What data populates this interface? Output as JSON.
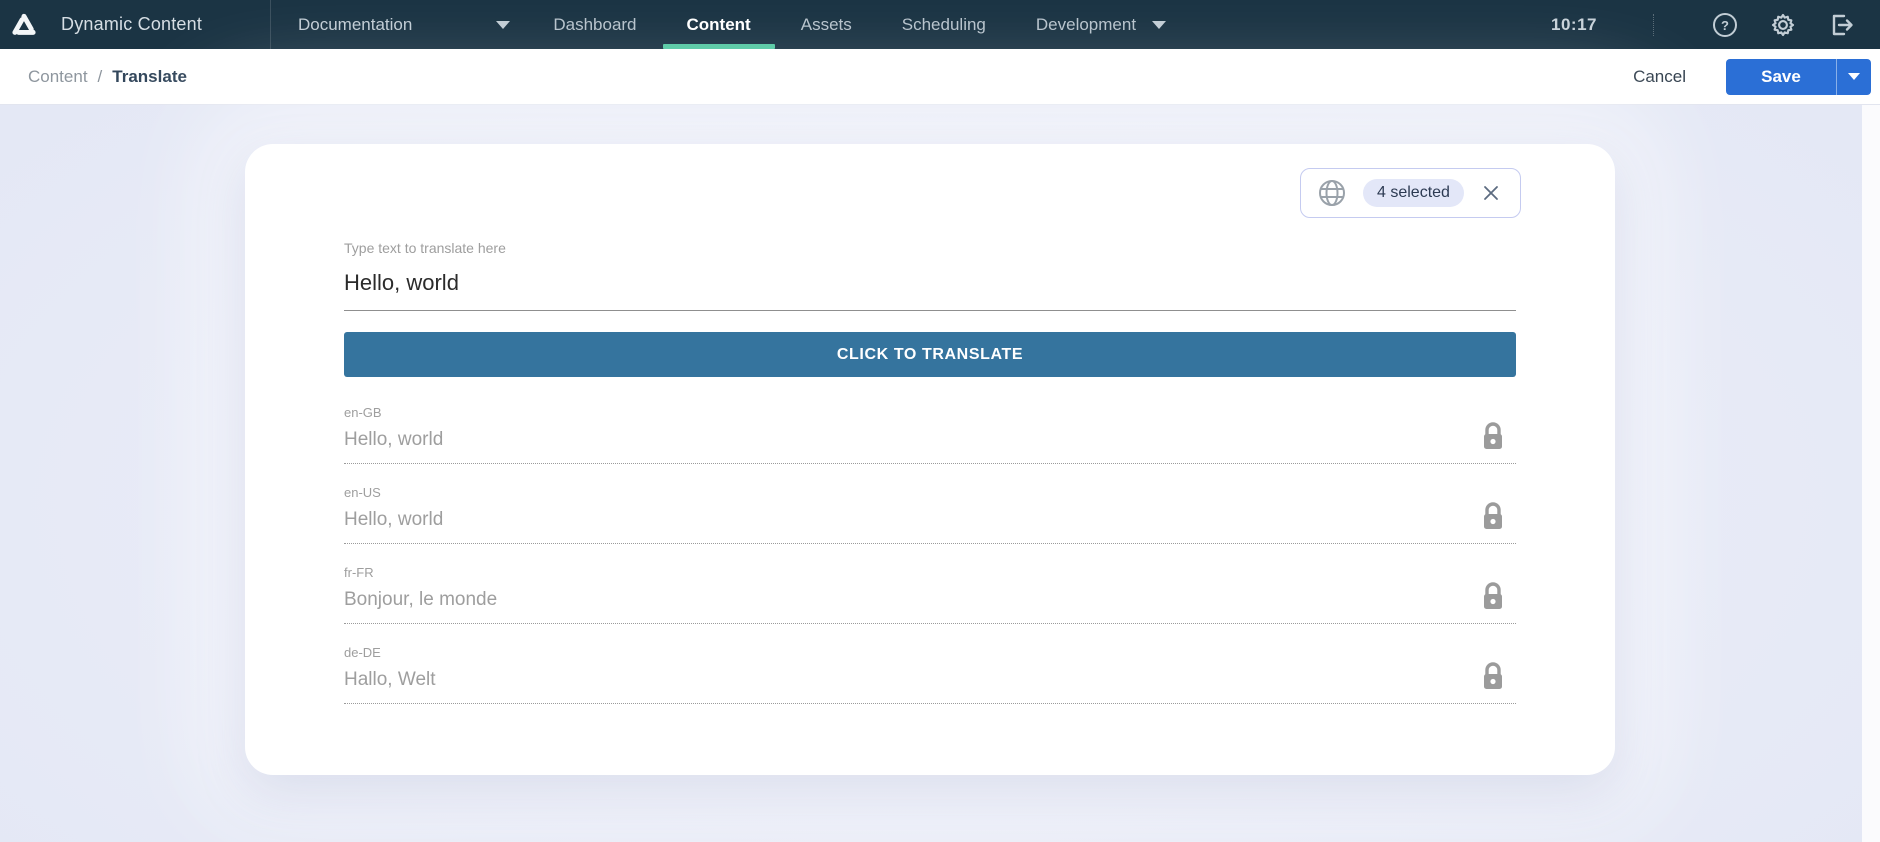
{
  "topbar": {
    "app_title": "Dynamic Content",
    "documentation_label": "Documentation",
    "tabs": [
      {
        "label": "Dashboard",
        "active": false
      },
      {
        "label": "Content",
        "active": true
      },
      {
        "label": "Assets",
        "active": false
      },
      {
        "label": "Scheduling",
        "active": false
      },
      {
        "label": "Development",
        "active": false,
        "has_dropdown": true
      }
    ],
    "time": "10:17",
    "icons": [
      "help-icon",
      "settings-icon",
      "logout-icon"
    ]
  },
  "toolbar": {
    "breadcrumb": {
      "parent": "Content",
      "separator": "/",
      "current": "Translate"
    },
    "cancel_label": "Cancel",
    "save_label": "Save"
  },
  "card": {
    "locale_chip": {
      "icon": "globe-icon",
      "selected_count_label": "4 selected",
      "close_icon": "close-icon"
    },
    "form": {
      "source_label": "Type text to translate here",
      "source_value": "Hello, world",
      "translate_button_label": "CLICK TO TRANSLATE",
      "locales": [
        {
          "code": "en-GB",
          "value": "Hello, world",
          "locked": true
        },
        {
          "code": "en-US",
          "value": "Hello, world",
          "locked": true
        },
        {
          "code": "fr-FR",
          "value": "Bonjour, le monde",
          "locked": true
        },
        {
          "code": "de-DE",
          "value": "Hallo, Welt",
          "locked": true
        }
      ]
    }
  },
  "colors": {
    "topbar_bg": "#1b3444",
    "active_tab_underline": "#55c9a3",
    "save_button": "#2b6fd6",
    "translate_button": "#35749e",
    "content_bg": "#e9ecf8",
    "chip_border": "#c5cbf0",
    "chip_pill_bg": "#e3e7f8",
    "muted_text": "#9e9e9e"
  }
}
